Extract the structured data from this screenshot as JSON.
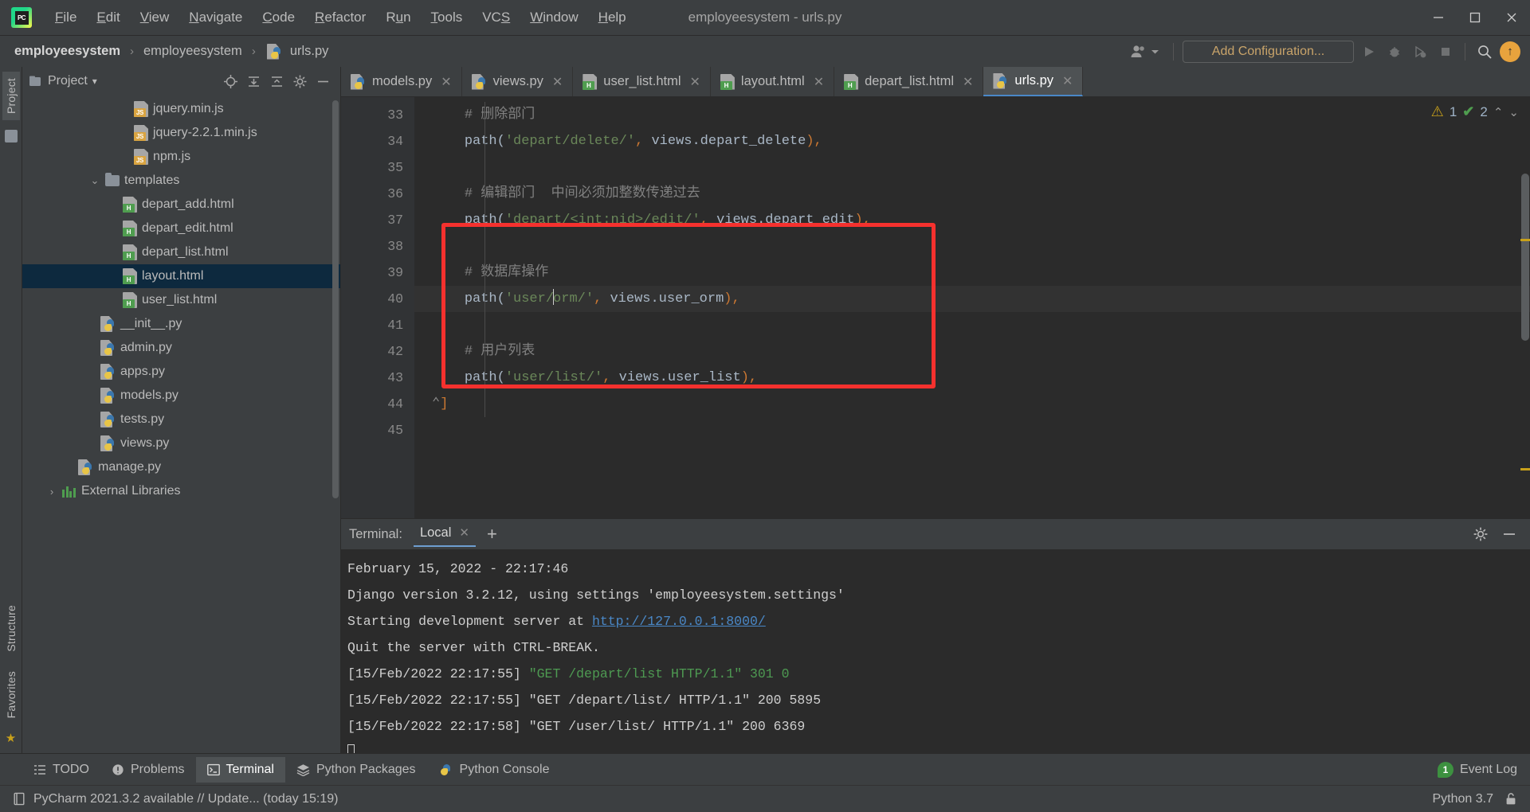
{
  "window": {
    "title": "employeesystem - urls.py",
    "logo_text": "PC",
    "controls": {
      "minimize": "─",
      "maximize": "❐",
      "close": "✕"
    }
  },
  "menubar": [
    {
      "label": "File"
    },
    {
      "label": "Edit"
    },
    {
      "label": "View"
    },
    {
      "label": "Navigate"
    },
    {
      "label": "Code"
    },
    {
      "label": "Refactor"
    },
    {
      "label": "Run"
    },
    {
      "label": "Tools"
    },
    {
      "label": "VCS"
    },
    {
      "label": "Window"
    },
    {
      "label": "Help"
    }
  ],
  "navbar": {
    "breadcrumbs": [
      {
        "label": "employeesystem"
      },
      {
        "label": "employeesystem"
      },
      {
        "label": "urls.py"
      }
    ],
    "separator": "›",
    "add_configuration": "Add Configuration...",
    "avatar_initial": "↑"
  },
  "project_panel": {
    "title": "Project",
    "dropdown_caret": "▾",
    "tree": [
      {
        "label": "jquery.min.js",
        "icon": "js-file-icon",
        "indent": 4,
        "selected": false
      },
      {
        "label": "jquery-2.2.1.min.js",
        "icon": "js-file-icon",
        "indent": 4,
        "selected": false
      },
      {
        "label": "npm.js",
        "icon": "js-file-icon",
        "indent": 4,
        "selected": false
      },
      {
        "label": "templates",
        "icon": "folder-icon",
        "indent": 3,
        "selected": false,
        "expanded": true
      },
      {
        "label": "depart_add.html",
        "icon": "html-file-icon",
        "indent": 4,
        "selected": false
      },
      {
        "label": "depart_edit.html",
        "icon": "html-file-icon",
        "indent": 4,
        "selected": false
      },
      {
        "label": "depart_list.html",
        "icon": "html-file-icon",
        "indent": 4,
        "selected": false
      },
      {
        "label": "layout.html",
        "icon": "html-file-icon",
        "indent": 4,
        "selected": true
      },
      {
        "label": "user_list.html",
        "icon": "html-file-icon",
        "indent": 4,
        "selected": false
      },
      {
        "label": "__init__.py",
        "icon": "python-file-icon",
        "indent": 3,
        "selected": false
      },
      {
        "label": "admin.py",
        "icon": "python-file-icon",
        "indent": 3,
        "selected": false
      },
      {
        "label": "apps.py",
        "icon": "python-file-icon",
        "indent": 3,
        "selected": false
      },
      {
        "label": "models.py",
        "icon": "python-file-icon",
        "indent": 3,
        "selected": false
      },
      {
        "label": "tests.py",
        "icon": "python-file-icon",
        "indent": 3,
        "selected": false
      },
      {
        "label": "views.py",
        "icon": "python-file-icon",
        "indent": 3,
        "selected": false
      },
      {
        "label": "manage.py",
        "icon": "python-file-icon",
        "indent": 2,
        "selected": false
      },
      {
        "label": "External Libraries",
        "icon": "library-icon",
        "indent": 1,
        "selected": false,
        "collapsed": true
      }
    ]
  },
  "left_strip": {
    "top_tab": "Project",
    "bottom_tabs": [
      "Structure",
      "Favorites"
    ]
  },
  "editor_tabs": [
    {
      "label": "models.py",
      "icon": "python-file-icon",
      "active": false,
      "close": "✕"
    },
    {
      "label": "views.py",
      "icon": "python-file-icon",
      "active": false,
      "close": "✕"
    },
    {
      "label": "user_list.html",
      "icon": "html-file-icon",
      "active": false,
      "close": "✕"
    },
    {
      "label": "layout.html",
      "icon": "html-file-icon",
      "active": false,
      "close": "✕"
    },
    {
      "label": "depart_list.html",
      "icon": "html-file-icon",
      "active": false,
      "close": "✕"
    },
    {
      "label": "urls.py",
      "icon": "python-file-icon",
      "active": true,
      "close": "✕"
    }
  ],
  "editor": {
    "first_line_number": 33,
    "lines": [
      {
        "n": 33,
        "text": "    # 删除部门",
        "kind": "comment",
        "current": false
      },
      {
        "n": 34,
        "text": "    path('depart/delete/', views.depart_delete),",
        "kind": "path",
        "current": false
      },
      {
        "n": 35,
        "text": "",
        "kind": "blank",
        "current": false
      },
      {
        "n": 36,
        "text": "    # 编辑部门  中间必须加整数传递过去",
        "kind": "comment",
        "current": false
      },
      {
        "n": 37,
        "text": "    path('depart/<int:nid>/edit/', views.depart_edit),",
        "kind": "path",
        "current": false
      },
      {
        "n": 38,
        "text": "",
        "kind": "blank",
        "current": false
      },
      {
        "n": 39,
        "text": "    # 数据库操作",
        "kind": "comment",
        "current": false
      },
      {
        "n": 40,
        "text": "    path('user/orm/', views.user_orm),",
        "kind": "path",
        "current": true
      },
      {
        "n": 41,
        "text": "",
        "kind": "blank",
        "current": false
      },
      {
        "n": 42,
        "text": "    # 用户列表",
        "kind": "comment",
        "current": false
      },
      {
        "n": 43,
        "text": "    path('user/list/', views.user_list),",
        "kind": "path",
        "current": false
      },
      {
        "n": 44,
        "text": "]",
        "kind": "plain",
        "current": false
      },
      {
        "n": 45,
        "text": "",
        "kind": "blank",
        "current": false
      }
    ],
    "code_fragments": {
      "l33_comment": "# 删除部门",
      "l34_fn": "path(",
      "l34_str": "'depart/delete/'",
      "l34_comma": ",",
      "l34_arg": " views.depart_delete",
      "l34_end": "),",
      "l36_comment": "# 编辑部门  中间必须加整数传递过去",
      "l37_fn": "path(",
      "l37_str": "'depart/<int:nid>/edit/'",
      "l37_comma": ",",
      "l37_arg": " views.depart_edit",
      "l37_end": "),",
      "l39_comment": "# 数据库操作",
      "l40_fn": "path(",
      "l40_str_a": "'user/",
      "l40_str_b": "orm/'",
      "l40_comma": ",",
      "l40_arg": " views.user_orm",
      "l40_end": "),",
      "l42_comment": "# 用户列表",
      "l43_fn": "path(",
      "l43_str": "'user/list/'",
      "l43_comma": ",",
      "l43_arg": " views.user_list",
      "l43_end": "),",
      "l44_bracket": "]"
    },
    "inspection": {
      "warning_icon": "warning-triangle-icon",
      "warning_count": "1",
      "ok_icon": "check-marks-icon",
      "ok_count": "2",
      "up": "⌃",
      "down": "⌄"
    }
  },
  "terminal": {
    "label": "Terminal:",
    "tab": "Local",
    "tab_close": "✕",
    "add": "+",
    "lines": [
      {
        "text": "February 15, 2022 - 22:17:46",
        "style": "plain"
      },
      {
        "text": "Django version 3.2.12, using settings 'employeesystem.settings'",
        "style": "plain"
      },
      {
        "text": "Starting development server at ",
        "style": "link-prefix",
        "link": "http://127.0.0.1:8000/"
      },
      {
        "text": "Quit the server with CTRL-BREAK.",
        "style": "plain"
      },
      {
        "text": "[15/Feb/2022 22:17:55] ",
        "style": "req-green",
        "rest": "\"GET /depart/list HTTP/1.1\" 301 0"
      },
      {
        "text": "[15/Feb/2022 22:17:55] \"GET /depart/list/ HTTP/1.1\" 200 5895",
        "style": "plain"
      },
      {
        "text": "[15/Feb/2022 22:17:58] \"GET /user/list/ HTTP/1.1\" 200 6369",
        "style": "plain"
      },
      {
        "text": "",
        "style": "cursor"
      }
    ]
  },
  "tool_window_bar": {
    "items": [
      {
        "label": "TODO",
        "icon": "todo-icon",
        "active": false
      },
      {
        "label": "Problems",
        "icon": "problems-icon",
        "active": false
      },
      {
        "label": "Terminal",
        "icon": "terminal-icon",
        "active": true
      },
      {
        "label": "Python Packages",
        "icon": "packages-icon",
        "active": false
      },
      {
        "label": "Python Console",
        "icon": "python-console-icon",
        "active": false
      }
    ],
    "event_log": {
      "label": "Event Log",
      "badge": "1"
    }
  },
  "status_bar": {
    "message": "PyCharm 2021.3.2 available // Update... (today 15:19)",
    "interpreter": "Python 3.7",
    "lock_icon": "unlocked-icon"
  },
  "colors": {
    "bg_chrome": "#3c3f41",
    "bg_editor": "#2b2b2b",
    "accent_blue": "#4a88c7",
    "annotation_red": "#f5312e",
    "string_green": "#6a8759",
    "punct_orange": "#cc7832",
    "comment_gray": "#808080",
    "selection_navy": "#0d293e"
  }
}
